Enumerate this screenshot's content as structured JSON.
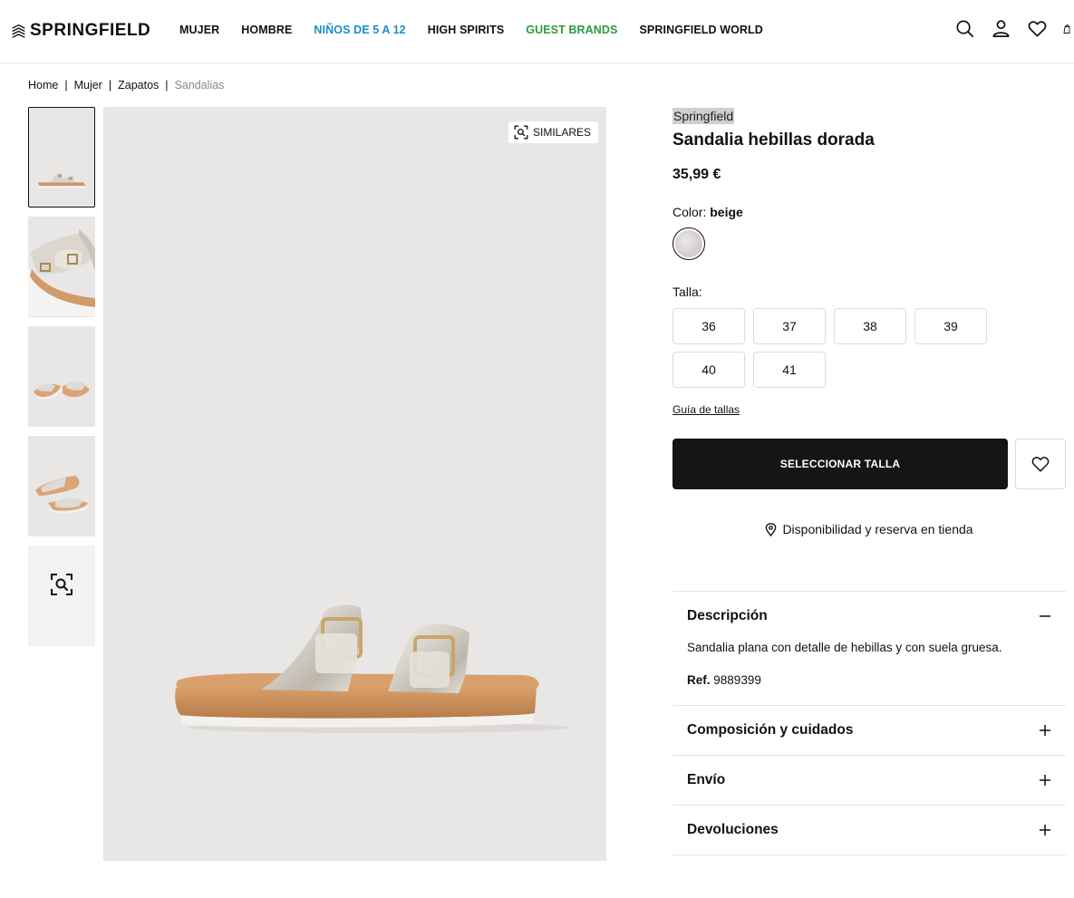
{
  "header": {
    "logo": "SPRINGFIELD",
    "nav": [
      {
        "label": "MUJER"
      },
      {
        "label": "HOMBRE"
      },
      {
        "label": "NIÑOS DE 5 A 12"
      },
      {
        "label": "HIGH SPIRITS"
      },
      {
        "label": "GUEST BRANDS"
      },
      {
        "label": "SPRINGFIELD WORLD"
      }
    ],
    "icons": [
      "search-icon",
      "user-icon",
      "heart-icon",
      "bag-icon"
    ],
    "colors": {
      "kids": "#1a8fc9",
      "guest_brands": "#2b9a3f"
    }
  },
  "breadcrumb": [
    "Home",
    "Mujer",
    "Zapatos",
    "Sandalias"
  ],
  "gallery": {
    "similares_label": "SIMILARES",
    "thumbnail_count": 5,
    "active_thumbnail": 1
  },
  "product": {
    "brand": "Springfield",
    "title": "Sandalia hebillas dorada",
    "price": "35,99 €",
    "color_label": "Color:",
    "color_value": "beige",
    "size_label": "Talla:",
    "sizes": [
      "36",
      "37",
      "38",
      "39",
      "40",
      "41"
    ],
    "size_guide": "Guía de tallas",
    "cta_label": "SELECCIONAR TALLA",
    "availability": "Disponibilidad y reserva en tienda",
    "cta_color": "#151515"
  },
  "accordion": {
    "description_title": "Descripción",
    "description_text": "Sandalia plana con detalle de hebillas y con suela gruesa.",
    "ref_label": "Ref.",
    "ref_value": "9889399",
    "composition_title": "Composición y cuidados",
    "shipping_title": "Envío",
    "returns_title": "Devoluciones"
  }
}
